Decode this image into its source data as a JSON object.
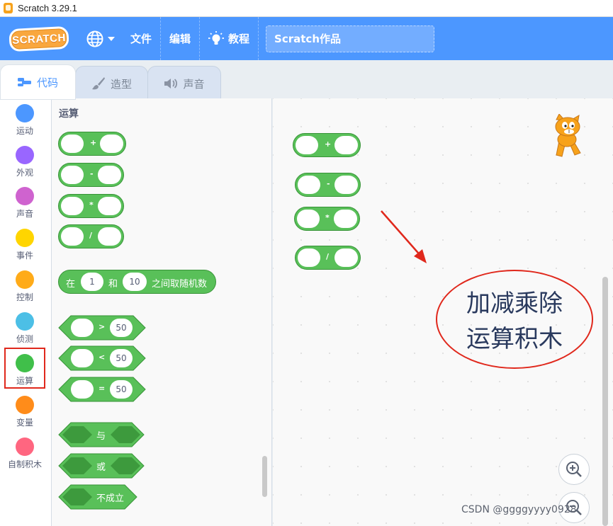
{
  "window": {
    "title": "Scratch 3.29.1"
  },
  "menubar": {
    "logo_text": "SCRATCH",
    "file": "文件",
    "edit": "编辑",
    "tutorials": "教程",
    "project_title": "Scratch作品"
  },
  "tabs": [
    {
      "label": "代码",
      "icon": "code-icon",
      "active": true
    },
    {
      "label": "造型",
      "icon": "brush-icon",
      "active": false
    },
    {
      "label": "声音",
      "icon": "speaker-icon",
      "active": false
    }
  ],
  "categories": [
    {
      "label": "运动",
      "color": "#4c97ff"
    },
    {
      "label": "外观",
      "color": "#9966ff"
    },
    {
      "label": "声音",
      "color": "#cf63cf"
    },
    {
      "label": "事件",
      "color": "#ffd500"
    },
    {
      "label": "控制",
      "color": "#ffab19"
    },
    {
      "label": "侦测",
      "color": "#4cbfe6"
    },
    {
      "label": "运算",
      "color": "#40bf4a",
      "selected": true
    },
    {
      "label": "变量",
      "color": "#ff8c1a"
    },
    {
      "label": "自制积木",
      "color": "#ff6680"
    }
  ],
  "palette": {
    "title": "运算",
    "ops": [
      "+",
      "-",
      "*",
      "/"
    ],
    "random": {
      "prefix": "在",
      "from": "1",
      "mid": "和",
      "to": "10",
      "suffix": "之间取随机数"
    },
    "compare": [
      {
        "op": ">",
        "value": "50"
      },
      {
        "op": "<",
        "value": "50"
      },
      {
        "op": "=",
        "value": "50"
      }
    ],
    "logic": {
      "and": "与",
      "or": "或",
      "not": "不成立"
    }
  },
  "workspace": {
    "ops": [
      "+",
      "-",
      "*",
      "/"
    ]
  },
  "annotation": {
    "line1": "加减乘除",
    "line2": "运算积木",
    "color": "#e0281c"
  },
  "watermark": "CSDN @ggggyyyy0928",
  "colors": {
    "accent": "#4c97ff",
    "operators": "#59c059",
    "operators_border": "#389438"
  }
}
